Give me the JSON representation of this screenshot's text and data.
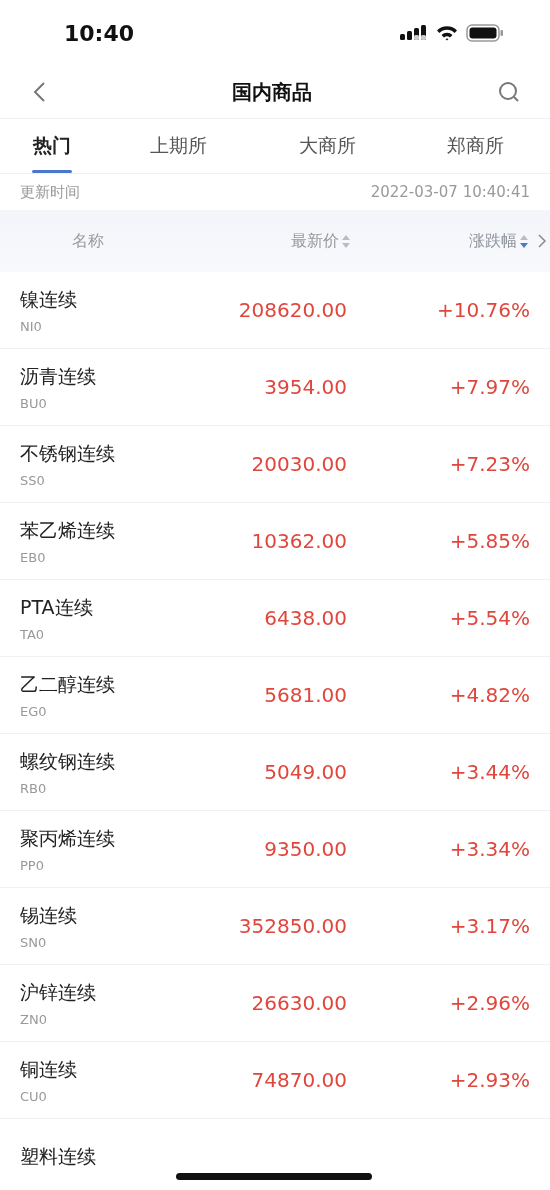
{
  "status_bar": {
    "time": "10:40"
  },
  "nav": {
    "title": "国内商品"
  },
  "tabs": [
    {
      "label": "热门",
      "selected": true
    },
    {
      "label": "上期所",
      "selected": false
    },
    {
      "label": "大商所",
      "selected": false
    },
    {
      "label": "郑商所",
      "selected": false
    }
  ],
  "update": {
    "label": "更新时间",
    "time": "2022-03-07 10:40:41"
  },
  "columns": [
    {
      "label": "名称",
      "sortable": false
    },
    {
      "label": "最新价",
      "sortable": true,
      "sorted_desc": false
    },
    {
      "label": "涨跌幅",
      "sortable": true,
      "sorted_desc": true
    }
  ],
  "rows": [
    {
      "name": "镍连续",
      "code": "NI0",
      "price": "208620.00",
      "change": "+10.76%",
      "rising": true
    },
    {
      "name": "沥青连续",
      "code": "BU0",
      "price": "3954.00",
      "change": "+7.97%",
      "rising": true
    },
    {
      "name": "不锈钢连续",
      "code": "SS0",
      "price": "20030.00",
      "change": "+7.23%",
      "rising": true
    },
    {
      "name": "苯乙烯连续",
      "code": "EB0",
      "price": "10362.00",
      "change": "+5.85%",
      "rising": true
    },
    {
      "name": "PTA连续",
      "code": "TA0",
      "price": "6438.00",
      "change": "+5.54%",
      "rising": true
    },
    {
      "name": "乙二醇连续",
      "code": "EG0",
      "price": "5681.00",
      "change": "+4.82%",
      "rising": true
    },
    {
      "name": "螺纹钢连续",
      "code": "RB0",
      "price": "5049.00",
      "change": "+3.44%",
      "rising": true
    },
    {
      "name": "聚丙烯连续",
      "code": "PP0",
      "price": "9350.00",
      "change": "+3.34%",
      "rising": true
    },
    {
      "name": "锡连续",
      "code": "SN0",
      "price": "352850.00",
      "change": "+3.17%",
      "rising": true
    },
    {
      "name": "沪锌连续",
      "code": "ZN0",
      "price": "26630.00",
      "change": "+2.96%",
      "rising": true
    },
    {
      "name": "铜连续",
      "code": "CU0",
      "price": "74870.00",
      "change": "+2.93%",
      "rising": true
    },
    {
      "name": "塑料连续"
    }
  ]
}
